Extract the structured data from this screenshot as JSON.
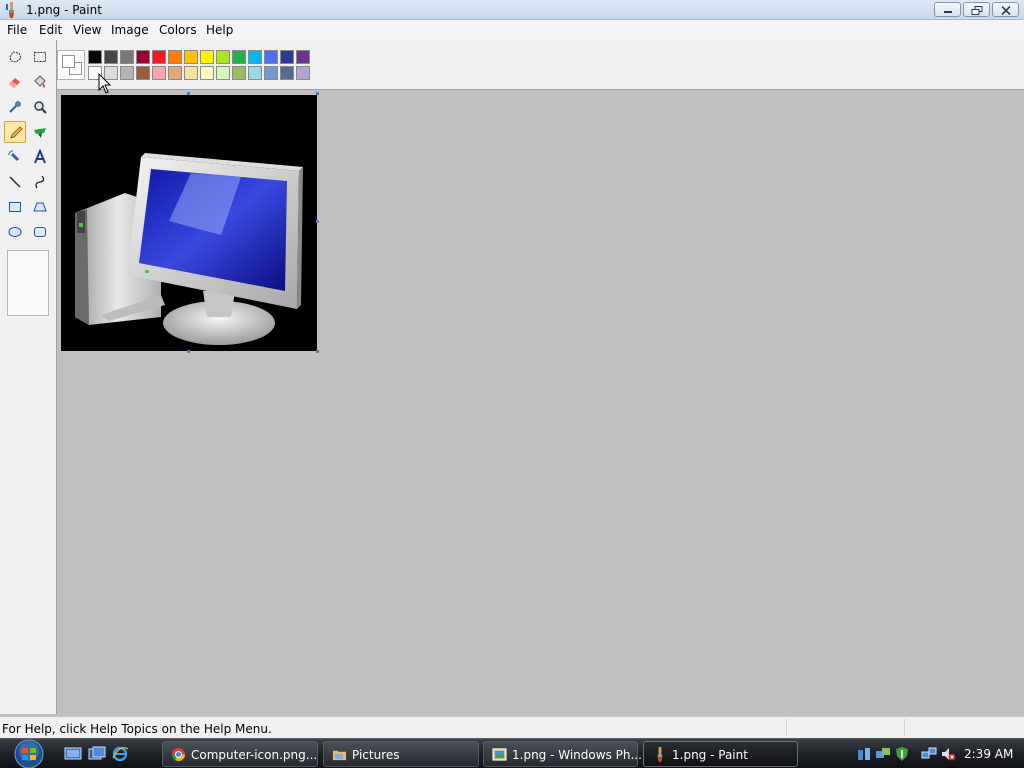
{
  "window": {
    "title": "1.png - Paint"
  },
  "menu": [
    "File",
    "Edit",
    "View",
    "Image",
    "Colors",
    "Help"
  ],
  "palette": {
    "row1": [
      "#000000",
      "#464646",
      "#787878",
      "#990030",
      "#ed1c24",
      "#ff7e00",
      "#ffc20e",
      "#fff200",
      "#a8e61d",
      "#22b14c",
      "#00b7ef",
      "#4d6df3",
      "#2f3699",
      "#6f3198"
    ],
    "row2": [
      "#ffffff",
      "#dcdcdc",
      "#b4b4b4",
      "#9c5a3c",
      "#ffa3b1",
      "#e5aa7a",
      "#f5e49c",
      "#fff9bd",
      "#d3f9bc",
      "#9dbb61",
      "#99d9ea",
      "#709ad1",
      "#546d8e",
      "#b5a5d5"
    ]
  },
  "status": {
    "help_text": "For Help, click Help Topics on the Help Menu."
  },
  "taskbar": {
    "buttons": [
      {
        "label": "Computer-icon.png...",
        "icon": "chrome-icon",
        "active": false
      },
      {
        "label": "Pictures",
        "icon": "folder-icon",
        "active": false
      },
      {
        "label": "1.png - Windows Ph...",
        "icon": "photo-viewer-icon",
        "active": false
      },
      {
        "label": "1.png - Paint",
        "icon": "paint-icon",
        "active": true
      }
    ],
    "clock": "2:39 AM"
  }
}
